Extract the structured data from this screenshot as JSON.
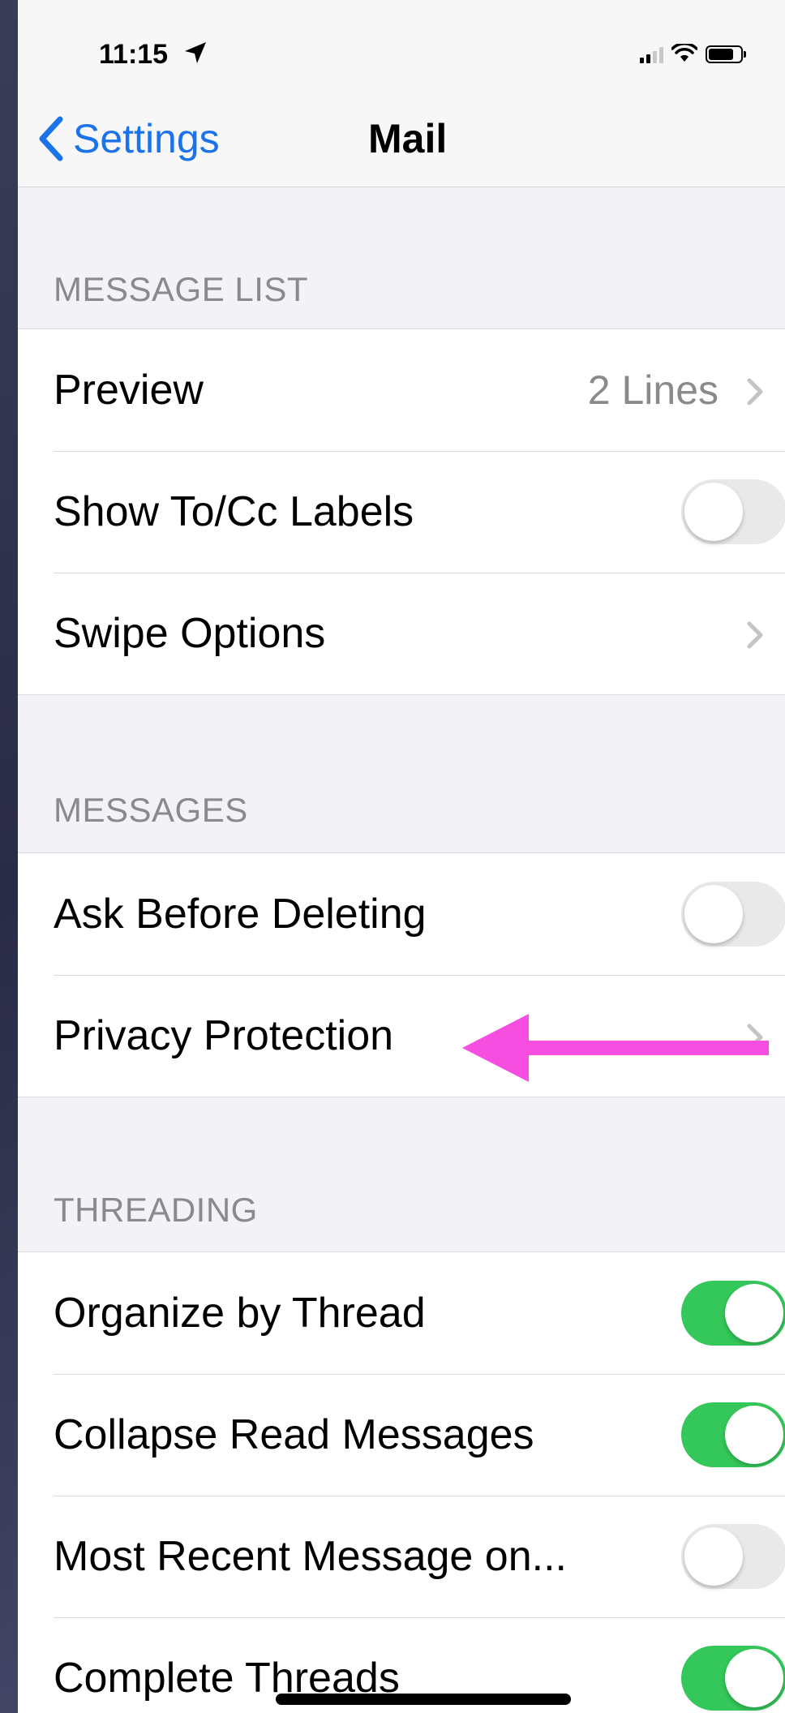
{
  "status_bar": {
    "time": "11:15"
  },
  "nav": {
    "back_label": "Settings",
    "title": "Mail"
  },
  "sections": {
    "message_list": {
      "header": "MESSAGE LIST",
      "preview": {
        "label": "Preview",
        "value": "2 Lines"
      },
      "show_to_cc": {
        "label": "Show To/Cc Labels",
        "on": false
      },
      "swipe_options": {
        "label": "Swipe Options"
      }
    },
    "messages": {
      "header": "MESSAGES",
      "ask_before_deleting": {
        "label": "Ask Before Deleting",
        "on": false
      },
      "privacy_protection": {
        "label": "Privacy Protection"
      }
    },
    "threading": {
      "header": "THREADING",
      "organize_by_thread": {
        "label": "Organize by Thread",
        "on": true
      },
      "collapse_read": {
        "label": "Collapse Read Messages",
        "on": true
      },
      "most_recent": {
        "label": "Most Recent Message on...",
        "on": false
      },
      "complete_threads": {
        "label": "Complete Threads",
        "on": true
      }
    }
  },
  "colors": {
    "accent": "#1a73e8",
    "toggle_on": "#34c759",
    "annotation_arrow": "#f64ee0"
  },
  "icons": [
    "location-arrow-icon",
    "signal-icon",
    "wifi-icon",
    "battery-icon",
    "chevron-left-icon",
    "chevron-right-icon"
  ]
}
